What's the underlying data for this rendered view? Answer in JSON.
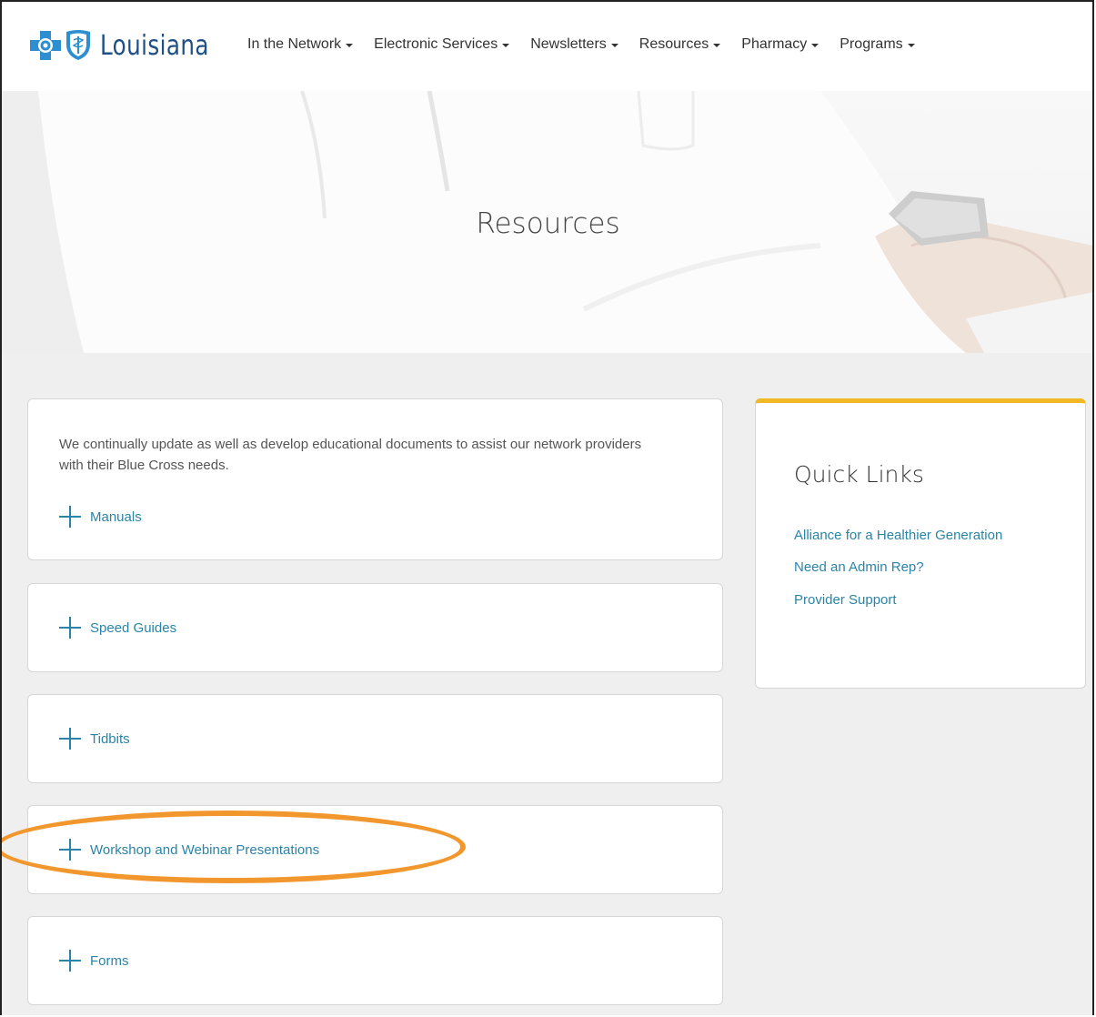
{
  "header": {
    "brand": "Louisiana",
    "nav": [
      {
        "label": "In the Network"
      },
      {
        "label": "Electronic Services"
      },
      {
        "label": "Newsletters"
      },
      {
        "label": "Resources"
      },
      {
        "label": "Pharmacy"
      },
      {
        "label": "Programs"
      }
    ]
  },
  "hero": {
    "title": "Resources"
  },
  "main": {
    "intro": "We continually update as well as develop educational documents to assist our network providers with their Blue Cross needs.",
    "sections": [
      {
        "label": "Manuals"
      },
      {
        "label": "Speed Guides"
      },
      {
        "label": "Tidbits"
      },
      {
        "label": "Workshop and Webinar Presentations"
      },
      {
        "label": "Forms"
      }
    ]
  },
  "quick_links": {
    "title": "Quick Links",
    "links": [
      {
        "label": "Alliance for a Healthier Generation"
      },
      {
        "label": "Need an Admin Rep?"
      },
      {
        "label": "Provider Support"
      }
    ]
  },
  "colors": {
    "link": "#2a84a7",
    "brand": "#1e4f86",
    "quick_links_accent": "#f2b824",
    "annotation": "#f2972e"
  },
  "icons": [
    "blue-cross-logo-icon",
    "blue-shield-logo-icon",
    "chevron-down-icon",
    "plus-icon"
  ]
}
